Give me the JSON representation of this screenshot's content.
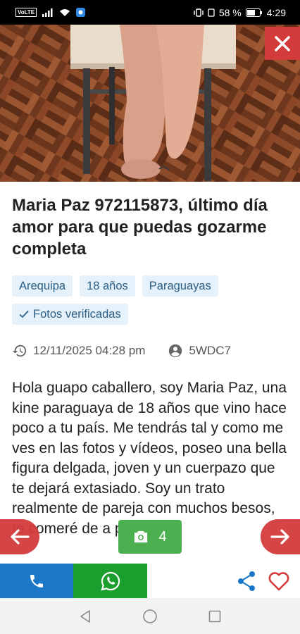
{
  "status_bar": {
    "volte": "VoLTE",
    "battery_percent": "58 %",
    "time": "4:29"
  },
  "hero": {
    "photo_subject": "feet-on-parquet-photo"
  },
  "listing": {
    "title": "Maria Paz 972115873, último día amor para que puedas gozarme completa",
    "tags": [
      "Arequipa",
      "18 años",
      "Paraguayas"
    ],
    "verified_label": "Fotos verificadas",
    "date": "12/11/2025 04:28 pm",
    "code": "5WDC7",
    "description": "Hola guapo caballero, soy Maria Paz, una kine paraguaya de 18 años que vino hace poco a tu país. Me tendrás tal y como me ves en las fotos y vídeos, poseo una bella figura delgada, joven y un cuerpazo que te dejará extasiado. Soy un trato realmente de pareja con muchos besos, te comeré de a poco"
  },
  "gallery": {
    "photo_count": "4"
  },
  "colors": {
    "accent_red": "#d43c3c",
    "call_blue": "#1b78c8",
    "whatsapp_green": "#1a9e2e",
    "counter_green": "#4caf50",
    "tag_bg": "#e5f2fb",
    "tag_text": "#2a5e86"
  }
}
